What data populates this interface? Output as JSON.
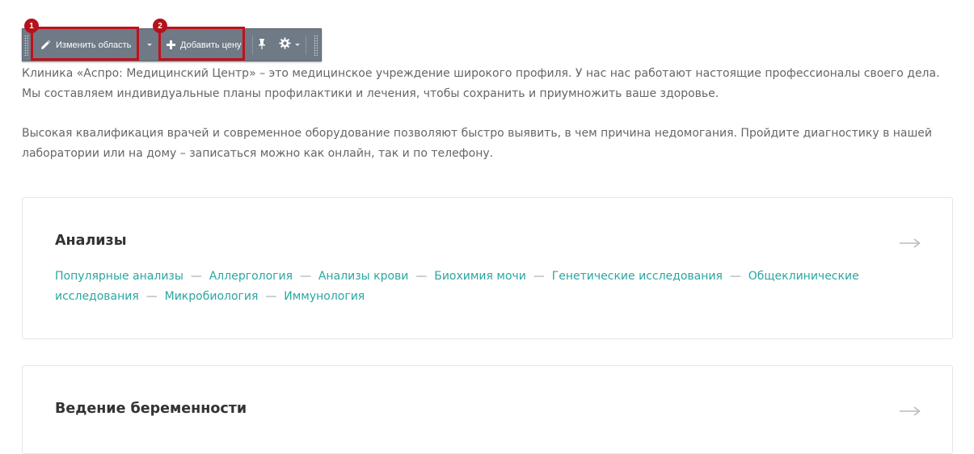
{
  "toolbar": {
    "edit_label": "Изменить область",
    "add_label": "Добавить цену",
    "edit_icon": "pencil-icon",
    "add_icon": "plus-icon",
    "pin_icon": "pin-icon",
    "settings_icon": "gear-icon",
    "badge_1": "1",
    "badge_2": "2",
    "highlight_color": "#c0111a"
  },
  "intro": {
    "p1": "Клиника «Аспро: Медицинский Центр» – это медицинское учреждение широкого профиля. У нас нас работают настоящие профессионалы своего дела. Мы составляем индивидуальные планы профилактики и лечения, чтобы сохранить и приумножить ваше здоровье.",
    "p2": "Высокая квалификация врачей и современное оборудование позволяют быстро выявить, в чем причина недомогания. Пройдите диагностику в нашей лаборатории или на дому – записаться можно как онлайн, так и по телефону."
  },
  "cards": [
    {
      "title": "Анализы",
      "links": [
        "Популярные анализы",
        "Аллергология",
        "Анализы крови",
        "Биохимия мочи",
        "Генетические исследования",
        "Общеклинические исследования",
        "Микробиология",
        "Иммунология"
      ]
    },
    {
      "title": "Ведение беременности"
    }
  ],
  "separator": "—",
  "colors": {
    "link": "#2aa7a0",
    "toolbar": "#6f7a86",
    "text": "#666666"
  }
}
